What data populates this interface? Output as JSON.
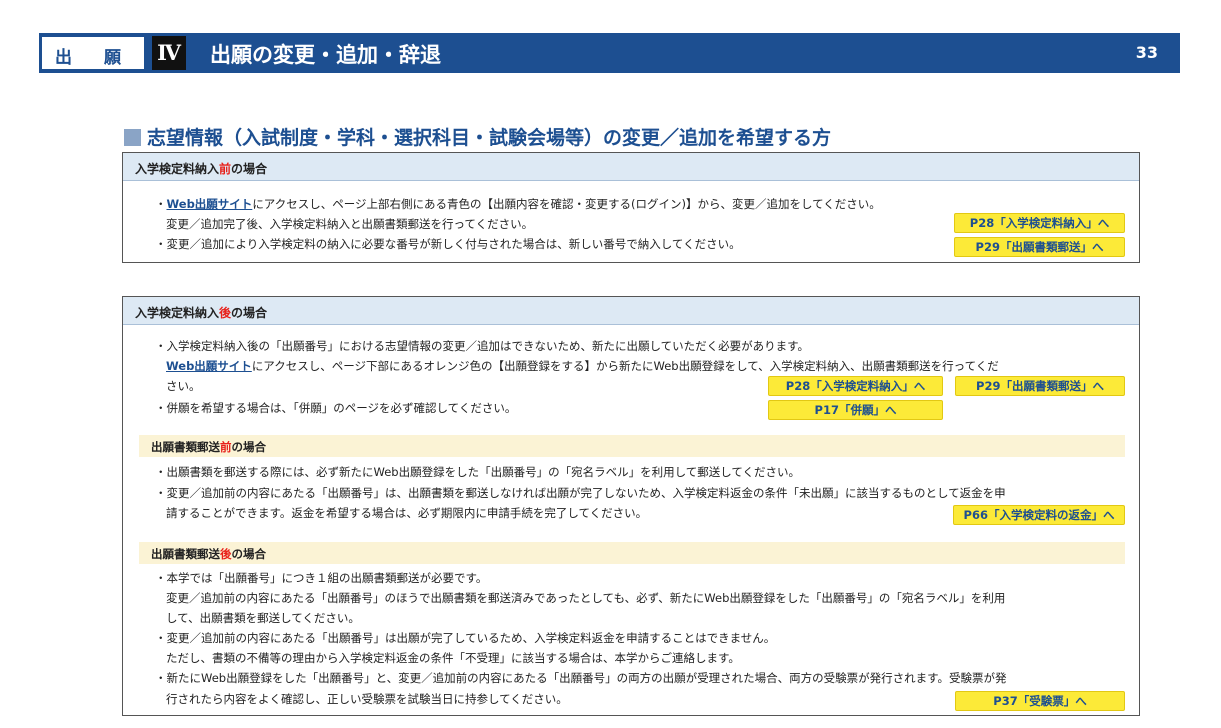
{
  "header": {
    "left_char1": "出",
    "left_char2": "願",
    "section_numeral": "Ⅳ",
    "title": "出願の変更・追加・辞退",
    "page_number": "33"
  },
  "section": {
    "title": "志望情報（入試制度・学科・選択科目・試験会場等）の変更／追加を希望する方"
  },
  "box1": {
    "heading_pre": "入学検定料納入",
    "heading_em": "前",
    "heading_post": "の場合",
    "l1_pre": "・",
    "l1_link": "Web出願サイト",
    "l1_post": "にアクセスし、ページ上部右側にある青色の【出願内容を確認・変更する(ログイン)】から、変更／追加をしてください。",
    "l2": "変更／追加完了後、入学検定料納入と出願書類郵送を行ってください。",
    "l3": "・変更／追加により入学検定料の納入に必要な番号が新しく付与された場合は、新しい番号で納入してください。",
    "btn1": "P28「入学検定料納入」へ",
    "btn2": "P29「出願書類郵送」へ"
  },
  "box2": {
    "heading_pre": "入学検定料納入",
    "heading_em": "後",
    "heading_post": "の場合",
    "l1": "・入学検定料納入後の「出願番号」における志望情報の変更／追加はできないため、新たに出願していただく必要があります。",
    "l2_link": "Web出願サイト",
    "l2_post": "にアクセスし、ページ下部にあるオレンジ色の【出願登録をする】から新たにWeb出願登録をして、入学検定料納入、出願書類郵送を行ってくだ",
    "l3": "さい。",
    "l4": "・併願を希望する場合は、「併願」のページを必ず確認してください。",
    "btn1": "P28「入学検定料納入」へ",
    "btn2": "P29「出願書類郵送」へ",
    "btn3": "P17「併願」へ",
    "sub1": {
      "heading_pre": "出願書類郵送",
      "heading_em": "前",
      "heading_post": "の場合",
      "l1": "・出願書類を郵送する際には、必ず新たにWeb出願登録をした「出願番号」の「宛名ラベル」を利用して郵送してください。",
      "l2": "・変更／追加前の内容にあたる「出願番号」は、出願書類を郵送しなければ出願が完了しないため、入学検定料返金の条件「未出願」に該当するものとして返金を申",
      "l3": "請することができます。返金を希望する場合は、必ず期限内に申請手続を完了してください。",
      "btn": "P66「入学検定料の返金」へ"
    },
    "sub2": {
      "heading_pre": "出願書類郵送",
      "heading_em": "後",
      "heading_post": "の場合",
      "l1": "・本学では「出願番号」につき１組の出願書類郵送が必要です。",
      "l2": "変更／追加前の内容にあたる「出願番号」のほうで出願書類を郵送済みであったとしても、必ず、新たにWeb出願登録をした「出願番号」の「宛名ラベル」を利用",
      "l3": "して、出願書類を郵送してください。",
      "l4": "・変更／追加前の内容にあたる「出願番号」は出願が完了しているため、入学検定料返金を申請することはできません。",
      "l5": "ただし、書類の不備等の理由から入学検定料返金の条件「不受理」に該当する場合は、本学からご連絡します。",
      "l6": "・新たにWeb出願登録をした「出願番号」と、変更／追加前の内容にあたる「出願番号」の両方の出願が受理された場合、両方の受験票が発行されます。受験票が発",
      "l7": "行されたら内容をよく確認し、正しい受験票を試験当日に持参してください。",
      "btn": "P37「受験票」へ"
    }
  }
}
